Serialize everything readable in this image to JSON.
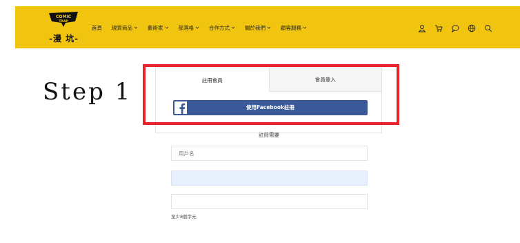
{
  "header": {
    "logo": {
      "top_text": "COMIC TRAP",
      "bottom_text": "-漫 坑-"
    },
    "nav": [
      {
        "label": "首頁",
        "dropdown": false
      },
      {
        "label": "現貨商品",
        "dropdown": true
      },
      {
        "label": "藝術家",
        "dropdown": true
      },
      {
        "label": "部落格",
        "dropdown": true
      },
      {
        "label": "合作方式",
        "dropdown": true
      },
      {
        "label": "關於我們",
        "dropdown": true
      },
      {
        "label": "顧客服務",
        "dropdown": true
      }
    ],
    "icons": [
      "user-icon",
      "cart-icon",
      "chat-icon",
      "globe-icon",
      "search-icon"
    ],
    "background": "#f1c40f"
  },
  "step_label": "Step 1",
  "tabs": {
    "register": "註冊會員",
    "login": "會員登入"
  },
  "facebook_button": {
    "label": "使用Facebook註冊",
    "color": "#3b5998"
  },
  "divider_text": "註冊需要",
  "form": {
    "username_placeholder": "用戶名",
    "password_hint": "至少8個字元"
  },
  "highlight_color": "#e8242b"
}
